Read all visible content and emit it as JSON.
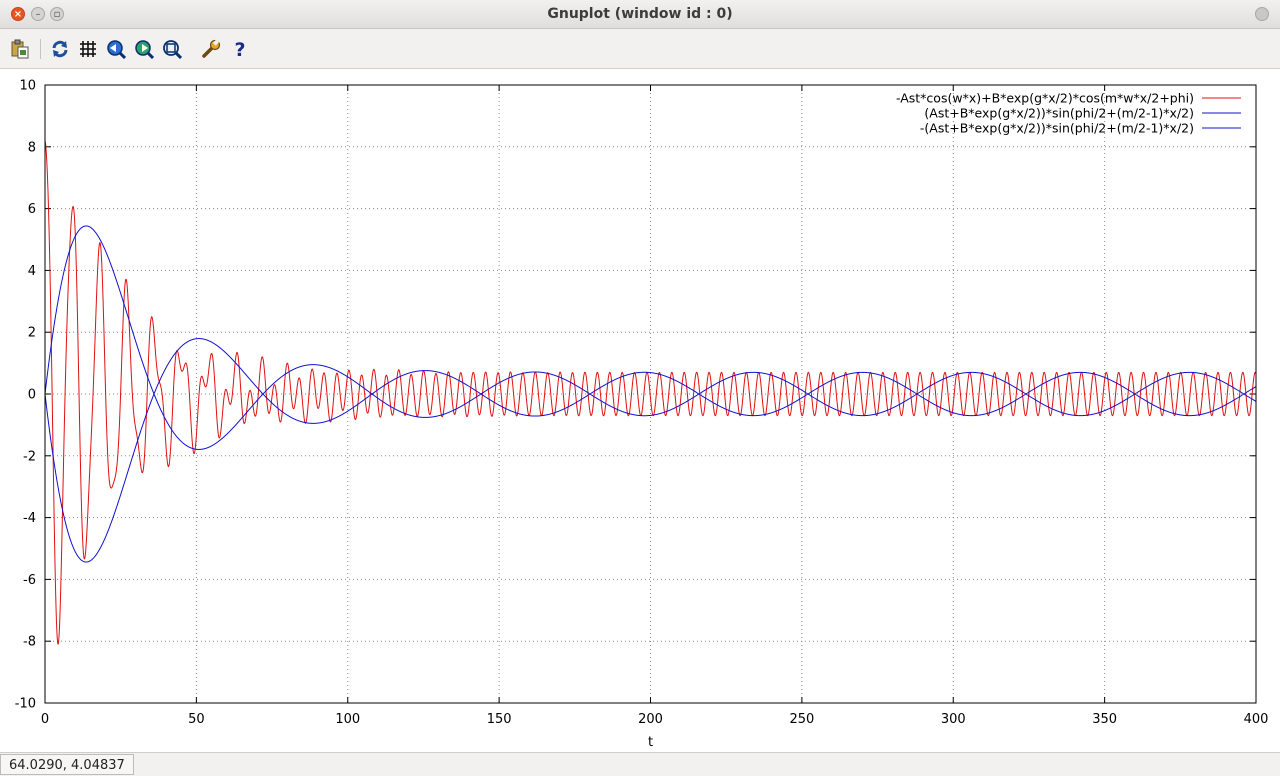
{
  "window": {
    "title": "Gnuplot (window id : 0)"
  },
  "toolbar": {
    "items": [
      {
        "name": "copy-clipboard-icon"
      },
      {
        "name": "replot-icon"
      },
      {
        "name": "grid-icon"
      },
      {
        "name": "zoom-previous-icon"
      },
      {
        "name": "zoom-next-icon"
      },
      {
        "name": "autoscale-icon"
      },
      {
        "name": "options-icon"
      },
      {
        "name": "help-icon"
      }
    ]
  },
  "status": {
    "text": "64.0290,  4.04837"
  },
  "chart_data": {
    "type": "line",
    "title": "",
    "xlabel": "t",
    "ylabel": "",
    "xlim": [
      0,
      400
    ],
    "ylim": [
      -10,
      10
    ],
    "xticks": [
      0,
      50,
      100,
      150,
      200,
      250,
      300,
      350,
      400
    ],
    "yticks": [
      -10,
      -8,
      -6,
      -4,
      -2,
      0,
      2,
      4,
      6,
      8,
      10
    ],
    "grid": true,
    "legend_position": "top-right",
    "series": [
      {
        "name": "-Ast*cos(w*x)+B*exp(g*x/2)*cos(m*w*x/2+phi)",
        "color": "#e01010",
        "model": {
          "kind": "carrier",
          "Ast": 0.7,
          "B": 8.9,
          "g": -0.08,
          "m": 0.9127,
          "period": 4.1,
          "phi": 0
        }
      },
      {
        "name": "(Ast+B*exp(g*x/2))*sin(phi/2+(m/2-1)*x/2)",
        "color": "#1010d0",
        "model": {
          "kind": "envelope",
          "sign": 1,
          "Ast": 0.7,
          "B": 8.9,
          "g": -0.08,
          "envelope_period": 72.0
        }
      },
      {
        "name": "-(Ast+B*exp(g*x/2))*sin(phi/2+(m/2-1)*x/2)",
        "color": "#1010d0",
        "model": {
          "kind": "envelope",
          "sign": -1,
          "Ast": 0.7,
          "B": 8.9,
          "g": -0.08,
          "envelope_period": 72.0
        }
      }
    ]
  }
}
